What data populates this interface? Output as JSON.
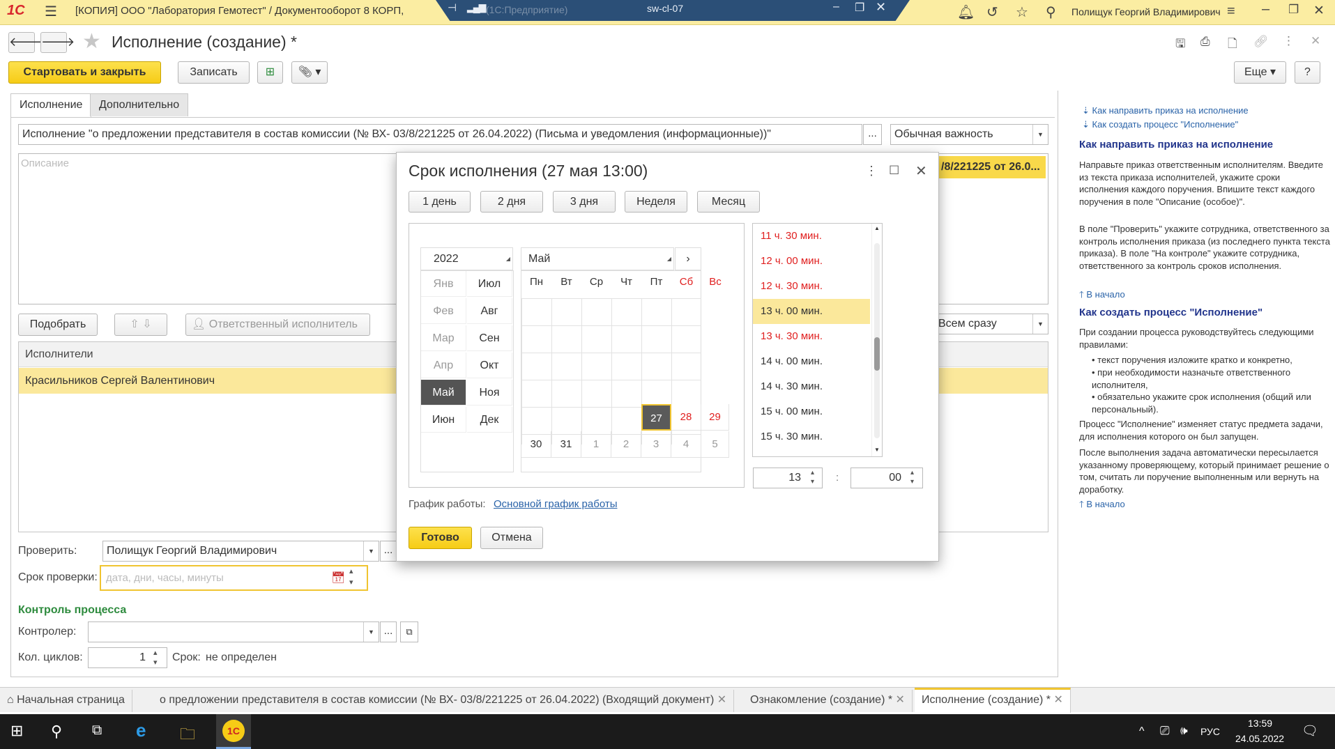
{
  "titlebar": {
    "logo": "1С",
    "title": "[КОПИЯ] ООО \"Лаборатория Гемотест\" / Документооборот 8 КОРП,",
    "title_tail": "(1С:Предприятие)",
    "rdp_host": "sw-cl-07",
    "user": "Полищук Георгий Владимирович"
  },
  "form": {
    "title": "Исполнение (создание) *",
    "start_close": "Стартовать и закрыть",
    "save": "Записать",
    "more": "Еще",
    "help": "?",
    "tabs": [
      "Исполнение",
      "Дополнительно"
    ],
    "name_value": "Исполнение \"о предложении представителя в состав комиссии (№ ВХ- 03/8/221225 от 26.04.2022) (Письма и уведомления (информационные))\"",
    "importance": "Обычная важность",
    "description_placeholder": "Описание",
    "subject_right": "/8/221225 от 26.0...",
    "pick": "Подобрать",
    "responsible": "Ответственный исполнитель",
    "mode": "Всем сразу",
    "performers_header": "Исполнители",
    "performer": "Красильников Сергей Валентинович",
    "check_label": "Проверить:",
    "check_value": "Полищук Георгий Владимирович",
    "check_date_label": "Срок проверки:",
    "check_date_placeholder": "дата, дни, часы, минуты",
    "control_header": "Контроль процесса",
    "controller_label": "Контролер:",
    "cycles_label": "Кол. циклов:",
    "cycles_value": "1",
    "term_label": "Срок:",
    "term_value": "не определен",
    "ellipsis": "..."
  },
  "help": {
    "link1": "Как направить приказ на исполнение",
    "link2": "Как создать процесс \"Исполнение\"",
    "h1": "Как направить приказ на исполнение",
    "p1": "Направьте приказ ответственным исполнителям. Введите из текста приказа исполнителей, укажите сроки исполнения каждого поручения. Впишите текст каждого поручения в поле \"Описание (особое)\".",
    "p2": "В поле \"Проверить\" укажите сотрудника, ответственного за контроль исполнения приказа (из последнего пункта текста приказа). В поле \"На контроле\" укажите сотрудника, ответственного за контроль сроков исполнения.",
    "to_top": "В начало",
    "h2": "Как создать процесс \"Исполнение\"",
    "p3": "При создании процесса руководствуйтесь следующими правилами:",
    "bullets": [
      "текст поручения изложите кратко и конкретно,",
      "при необходимости назначьте ответственного исполнителя,",
      "обязательно укажите срок исполнения (общий или персональный)."
    ],
    "p4": "Процесс \"Исполнение\" изменяет статус предмета задачи, для исполнения которого он был запущен.",
    "p5": "После выполнения задача автоматически пересылается указанному проверяющему, который принимает решение о том, считать ли поручение выполненным или вернуть на доработку.",
    "to_top2": "В начало"
  },
  "dialog": {
    "title": "Срок исполнения (27 мая 13:00)",
    "presets": [
      "1 день",
      "2 дня",
      "3 дня",
      "Неделя",
      "Месяц"
    ],
    "year": "2022",
    "month": "Май",
    "months_left": [
      "Янв",
      "Фев",
      "Мар",
      "Апр",
      "Май",
      "Июн"
    ],
    "months_right": [
      "Июл",
      "Авг",
      "Сен",
      "Окт",
      "Ноя",
      "Дек"
    ],
    "weekdays": [
      "Пн",
      "Вт",
      "Ср",
      "Чт",
      "Пт",
      "Сб",
      "Вс"
    ],
    "week_a": [
      "27",
      "28",
      "29"
    ],
    "week_b": [
      "30",
      "31",
      "1",
      "2",
      "3",
      "4",
      "5"
    ],
    "times": [
      "11 ч. 30 мин.",
      "12 ч. 00 мин.",
      "12 ч. 30 мин.",
      "13 ч. 00 мин.",
      "13 ч. 30 мин.",
      "14 ч. 00 мин.",
      "14 ч. 30 мин.",
      "15 ч. 00 мин.",
      "15 ч. 30 мин."
    ],
    "hours": "13",
    "minutes": "00",
    "colon": ":",
    "schedule_label": "График работы:",
    "schedule_link": "Основной график работы",
    "ok": "Готово",
    "cancel": "Отмена"
  },
  "bottom_tabs": [
    "Начальная страница",
    "о предложении представителя в состав комиссии (№ ВХ- 03/8/221225 от 26.04.2022) (Входящий документ)",
    "Ознакомление (создание) *",
    "Исполнение (создание) *"
  ],
  "taskbar": {
    "lang": "РУС",
    "time": "13:59",
    "date": "24.05.2022"
  },
  "colors": {
    "accent": "#f6cc16",
    "link": "#2a63a8",
    "weekend": "#e02020"
  }
}
